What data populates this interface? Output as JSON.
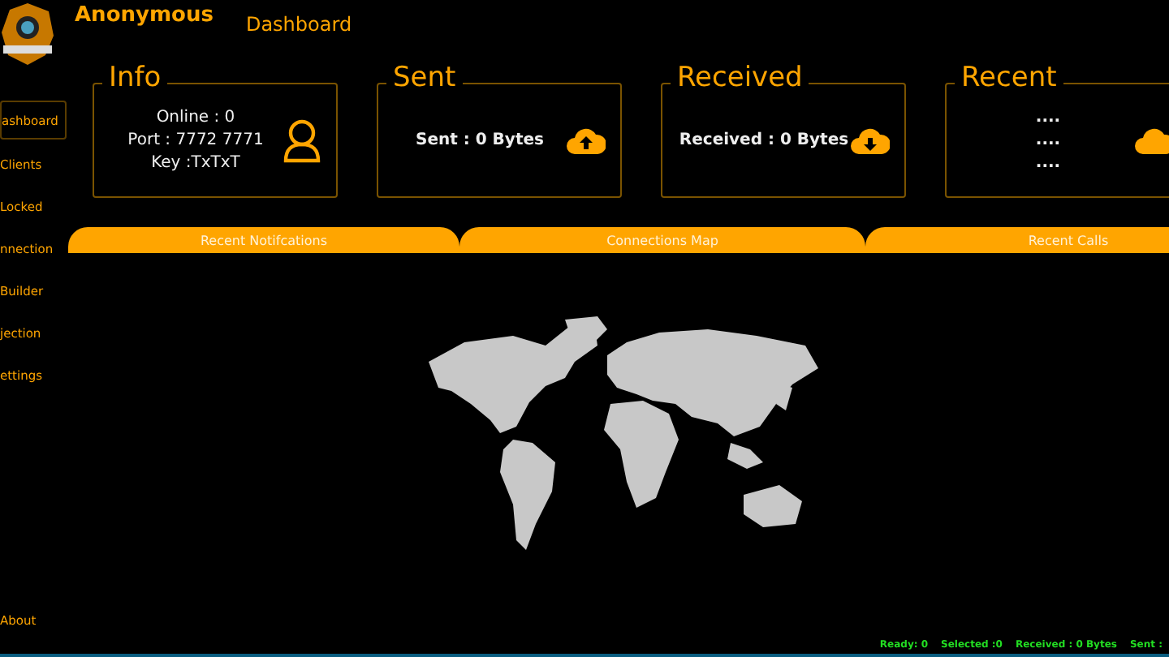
{
  "header": {
    "title": "Anonymous",
    "page": "Dashboard"
  },
  "sidebar": {
    "items": [
      {
        "label": "ashboard",
        "selected": true
      },
      {
        "label": "Clients",
        "selected": false
      },
      {
        "label": "Locked",
        "selected": false
      },
      {
        "label": "nnection",
        "selected": false
      },
      {
        "label": "Builder",
        "selected": false
      },
      {
        "label": "jection",
        "selected": false
      },
      {
        "label": "ettings",
        "selected": false
      }
    ],
    "footer": "About"
  },
  "cards": [
    {
      "title": "Info",
      "lines": [
        "Online : 0",
        "Port : 7772 7771",
        "Key :TxTxT"
      ]
    },
    {
      "title": "Sent",
      "lines": [
        "Sent : 0 Bytes"
      ]
    },
    {
      "title": "Received",
      "lines": [
        "Received : 0 Bytes"
      ]
    },
    {
      "title": "Recent",
      "lines": [
        "....",
        "....",
        "...."
      ]
    }
  ],
  "tabs": [
    {
      "label": "Recent Notifcations"
    },
    {
      "label": "Connections Map"
    },
    {
      "label": "Recent Calls"
    }
  ],
  "status_bar": [
    "Ready: 0",
    "Selected :0",
    "Received : 0 Bytes",
    "Sent :"
  ]
}
